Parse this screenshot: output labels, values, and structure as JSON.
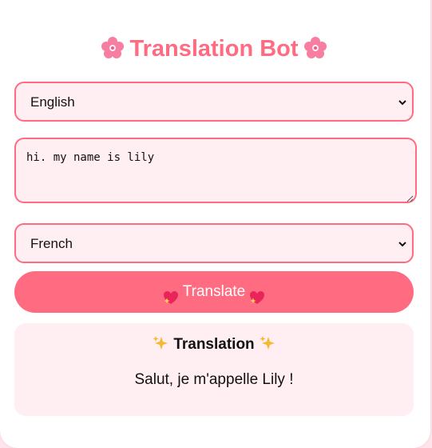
{
  "app": {
    "title": "Translation Bot"
  },
  "source_language": {
    "selected": "English"
  },
  "input": {
    "value": "hi. my name is lily"
  },
  "target_language": {
    "selected": "French"
  },
  "translate_button": {
    "label": "Translate"
  },
  "result": {
    "heading": "Translation",
    "text": "Salut, je m'appelle Lily !"
  },
  "colors": {
    "accent": "#ff6b81",
    "field_background": "#ffeef2",
    "page_background": "#ffe4ec"
  },
  "icons": {
    "title_decoration": "cherry-blossom-icon",
    "button_decoration": "sparkling-heart-icon",
    "result_decoration": "sparkles-icon"
  }
}
